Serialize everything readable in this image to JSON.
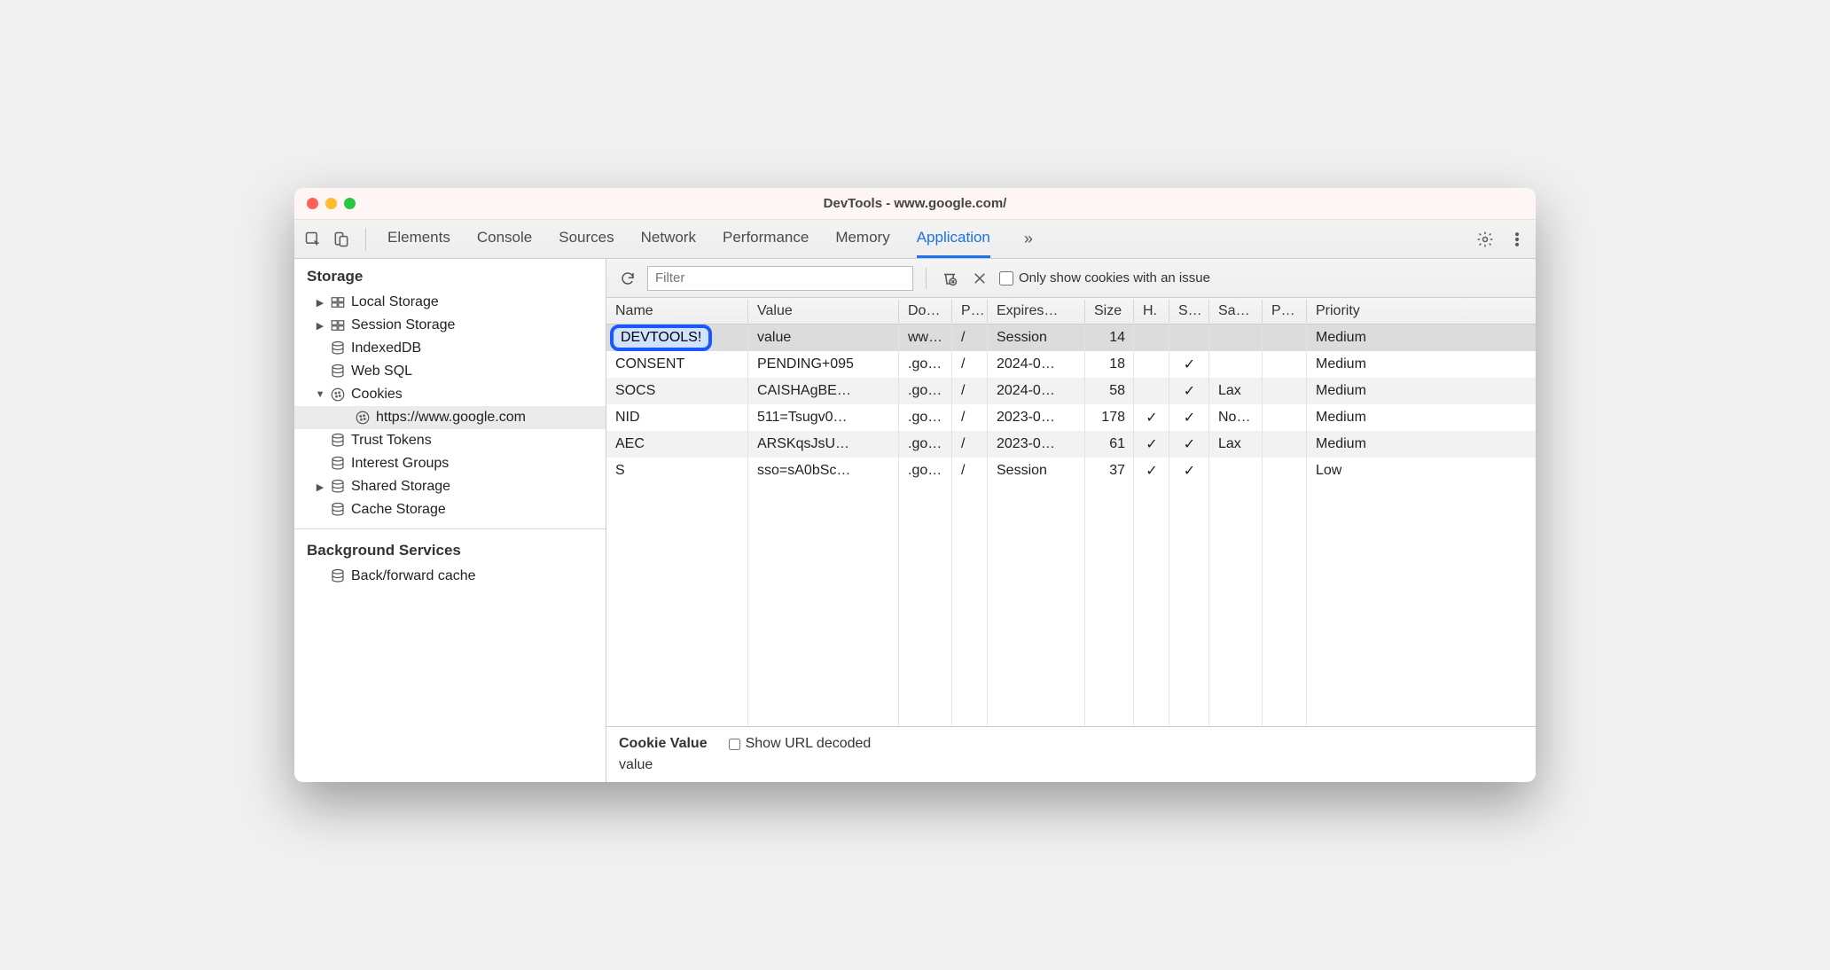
{
  "window": {
    "title": "DevTools - www.google.com/"
  },
  "toolbar": {
    "tabs": [
      "Elements",
      "Console",
      "Sources",
      "Network",
      "Performance",
      "Memory",
      "Application"
    ],
    "active_tab_index": 6,
    "more_glyph": "»"
  },
  "sidebar": {
    "sections": {
      "storage": {
        "title": "Storage",
        "items": [
          {
            "label": "Local Storage",
            "icon": "grid",
            "disclosure": "right",
            "indent": 1
          },
          {
            "label": "Session Storage",
            "icon": "grid",
            "disclosure": "right",
            "indent": 1
          },
          {
            "label": "IndexedDB",
            "icon": "db",
            "disclosure": "",
            "indent": 1
          },
          {
            "label": "Web SQL",
            "icon": "db",
            "disclosure": "",
            "indent": 1
          },
          {
            "label": "Cookies",
            "icon": "cookie",
            "disclosure": "down",
            "indent": 1
          },
          {
            "label": "https://www.google.com",
            "icon": "cookie",
            "disclosure": "",
            "indent": 2,
            "selected": true
          },
          {
            "label": "Trust Tokens",
            "icon": "db",
            "disclosure": "",
            "indent": 1
          },
          {
            "label": "Interest Groups",
            "icon": "db",
            "disclosure": "",
            "indent": 1
          },
          {
            "label": "Shared Storage",
            "icon": "db",
            "disclosure": "right",
            "indent": 1
          },
          {
            "label": "Cache Storage",
            "icon": "db",
            "disclosure": "",
            "indent": 1
          }
        ]
      },
      "background": {
        "title": "Background Services",
        "items": [
          {
            "label": "Back/forward cache",
            "icon": "db",
            "disclosure": "",
            "indent": 1
          }
        ]
      }
    }
  },
  "filter": {
    "placeholder": "Filter",
    "only_issue_label": "Only show cookies with an issue",
    "only_issue_checked": false
  },
  "table": {
    "columns": [
      "Name",
      "Value",
      "Do…",
      "P…",
      "Expires…",
      "Size",
      "H.",
      "S…",
      "Sa…",
      "P…",
      "Priority"
    ],
    "rows": [
      {
        "name": "DEVTOOLS!",
        "value": "value",
        "domain": "ww…",
        "path": "/",
        "expires": "Session",
        "size": "14",
        "http": "",
        "secure": "",
        "samesite": "",
        "partition": "",
        "priority": "Medium",
        "selected": true,
        "editing": true
      },
      {
        "name": "CONSENT",
        "value": "PENDING+095",
        "domain": ".go…",
        "path": "/",
        "expires": "2024-0…",
        "size": "18",
        "http": "",
        "secure": "✓",
        "samesite": "",
        "partition": "",
        "priority": "Medium"
      },
      {
        "name": "SOCS",
        "value": "CAISHAgBE…",
        "domain": ".go…",
        "path": "/",
        "expires": "2024-0…",
        "size": "58",
        "http": "",
        "secure": "✓",
        "samesite": "Lax",
        "partition": "",
        "priority": "Medium"
      },
      {
        "name": "NID",
        "value": "511=Tsugv0…",
        "domain": ".go…",
        "path": "/",
        "expires": "2023-0…",
        "size": "178",
        "http": "✓",
        "secure": "✓",
        "samesite": "No…",
        "partition": "",
        "priority": "Medium"
      },
      {
        "name": "AEC",
        "value": "ARSKqsJsU…",
        "domain": ".go…",
        "path": "/",
        "expires": "2023-0…",
        "size": "61",
        "http": "✓",
        "secure": "✓",
        "samesite": "Lax",
        "partition": "",
        "priority": "Medium"
      },
      {
        "name": "S",
        "value": "sso=sA0bSc…",
        "domain": ".go…",
        "path": "/",
        "expires": "Session",
        "size": "37",
        "http": "✓",
        "secure": "✓",
        "samesite": "",
        "partition": "",
        "priority": "Low"
      }
    ]
  },
  "detail": {
    "label": "Cookie Value",
    "decoded_label": "Show URL decoded",
    "decoded_checked": false,
    "value": "value"
  }
}
